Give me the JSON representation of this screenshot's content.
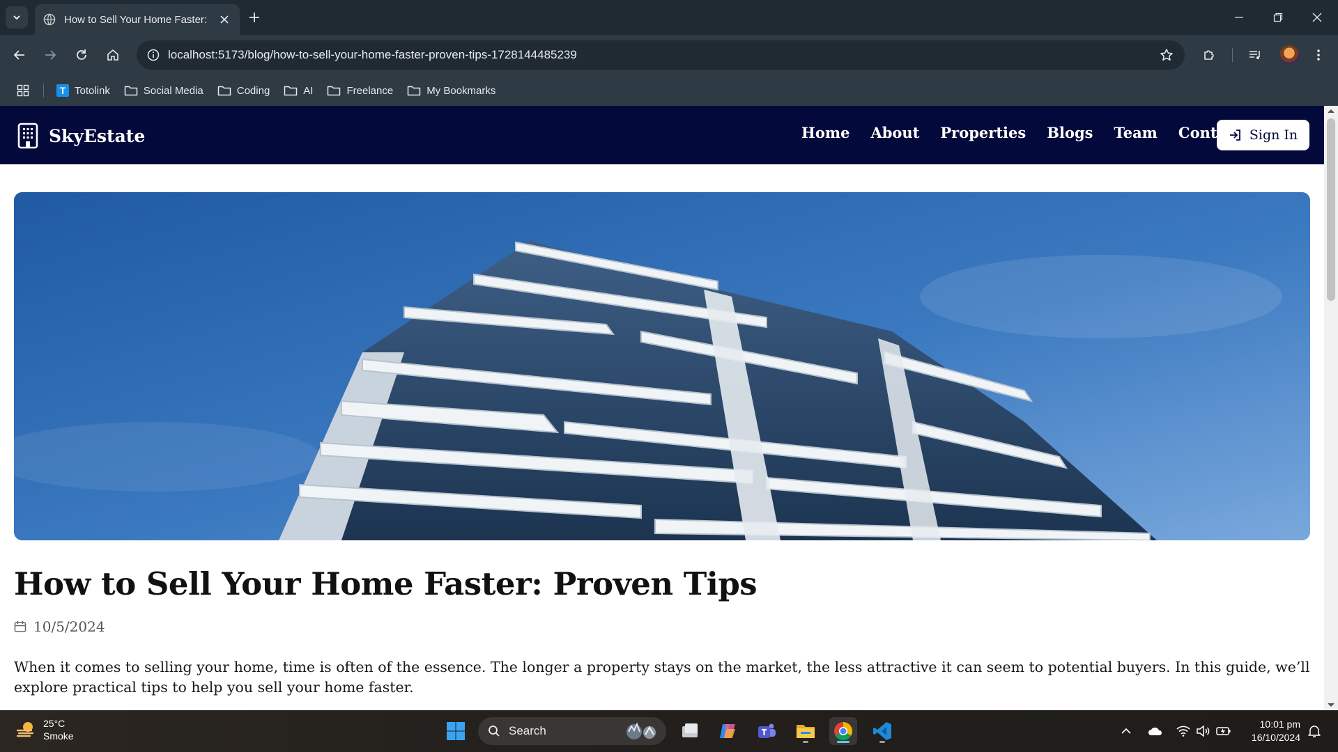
{
  "browser": {
    "tab_title": "How to Sell Your Home Faster: P",
    "url": "localhost:5173/blog/how-to-sell-your-home-faster-proven-tips-1728144485239",
    "bookmarks": [
      {
        "label": "Totolink",
        "icon": "totolink-logo"
      },
      {
        "label": "Social Media",
        "icon": "folder-icon"
      },
      {
        "label": "Coding",
        "icon": "folder-icon"
      },
      {
        "label": "AI",
        "icon": "folder-icon"
      },
      {
        "label": "Freelance",
        "icon": "folder-icon"
      },
      {
        "label": "My Bookmarks",
        "icon": "folder-icon"
      }
    ]
  },
  "site": {
    "brand": "SkyEstate",
    "nav": [
      "Home",
      "About",
      "Properties",
      "Blogs",
      "Team",
      "Contact"
    ],
    "signin_label": "Sign In",
    "colors": {
      "nav_bg": "#030a3b",
      "sky": "#3a76bd"
    }
  },
  "post": {
    "hero_image": "modern-apartment-building-photo",
    "title": "How to Sell Your Home Faster: Proven Tips",
    "date": "10/5/2024",
    "intro": "When it comes to selling your home, time is often of the essence. The longer a property stays on the market, the less attractive it can seem to potential buyers. In this guide, we’ll explore practical tips to help you sell your home faster."
  },
  "taskbar": {
    "weather_temp": "25°C",
    "weather_desc": "Smoke",
    "search_label": "Search",
    "time": "10:01 pm",
    "date": "16/10/2024"
  }
}
